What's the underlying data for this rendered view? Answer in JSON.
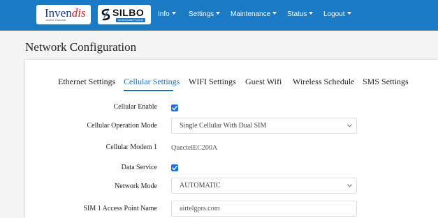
{
  "brand": {
    "logo1_name": "Invendis",
    "logo1_name_part1": "Inven",
    "logo1_name_part2": "dis",
    "logo1_tagline": "Invent, Discover",
    "logo2_name": "SILBO",
    "logo2_tagline": "An Invendis Product"
  },
  "nav": {
    "items": [
      {
        "label": "Info"
      },
      {
        "label": "Settings"
      },
      {
        "label": "Maintenance"
      },
      {
        "label": "Status"
      },
      {
        "label": "Logout"
      }
    ],
    "color": "#1a7bc4"
  },
  "page": {
    "title": "Network Configuration"
  },
  "tabs": {
    "items": [
      {
        "label": "Ethernet Settings"
      },
      {
        "label": "Cellular Settings"
      },
      {
        "label": "WIFI Settings"
      },
      {
        "label": "Guest Wifi"
      },
      {
        "label": "Wireless Schedule"
      },
      {
        "label": "SMS Settings"
      }
    ],
    "active": "Cellular Settings",
    "active_color": "#1a6fb5"
  },
  "form": {
    "cellular_enable": {
      "label": "Cellular Enable",
      "checked": true
    },
    "operation_mode": {
      "label": "Cellular Operation Mode",
      "value": "Single Cellular With Dual SIM"
    },
    "modem1": {
      "label": "Cellular Modem 1",
      "value": "QuectelEC200A"
    },
    "data_service": {
      "label": "Data Service",
      "checked": true
    },
    "network_mode": {
      "label": "Network Mode",
      "value": "AUTOMATIC"
    },
    "sim1_apn": {
      "label": "SIM 1 Access Point Name",
      "value": "airtelgprs.com"
    },
    "checkbox_color": "#1a73e8"
  }
}
